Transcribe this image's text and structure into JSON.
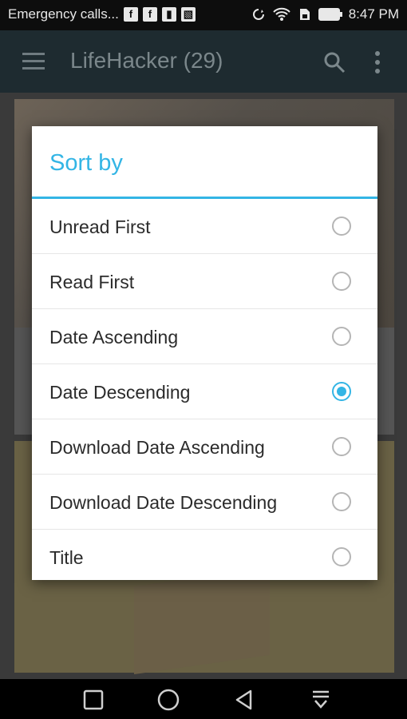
{
  "status_bar": {
    "carrier_text": "Emergency calls...",
    "time": "8:47 PM",
    "left_icons": [
      "facebook-icon",
      "facebook-icon",
      "battery-saver-icon",
      "image-icon"
    ],
    "right_icons": [
      "sync-icon",
      "wifi-icon",
      "sim-icon",
      "battery-icon"
    ]
  },
  "app_bar": {
    "title": "LifeHacker (29)",
    "icons": [
      "menu-icon",
      "search-icon",
      "more-vert-icon"
    ]
  },
  "dialog": {
    "title": "Sort by",
    "options": [
      {
        "label": "Unread First",
        "selected": false
      },
      {
        "label": "Read First",
        "selected": false
      },
      {
        "label": "Date Ascending",
        "selected": false
      },
      {
        "label": "Date Descending",
        "selected": true
      },
      {
        "label": "Download Date Ascending",
        "selected": false
      },
      {
        "label": "Download Date Descending",
        "selected": false
      },
      {
        "label": "Title",
        "selected": false
      }
    ]
  },
  "nav_bar": {
    "buttons": [
      "recent-apps-button",
      "home-button",
      "back-button",
      "notification-pull-button"
    ]
  },
  "colors": {
    "accent": "#33b5e5",
    "app_bar": "#263238",
    "dialog_bg": "#ffffff"
  }
}
